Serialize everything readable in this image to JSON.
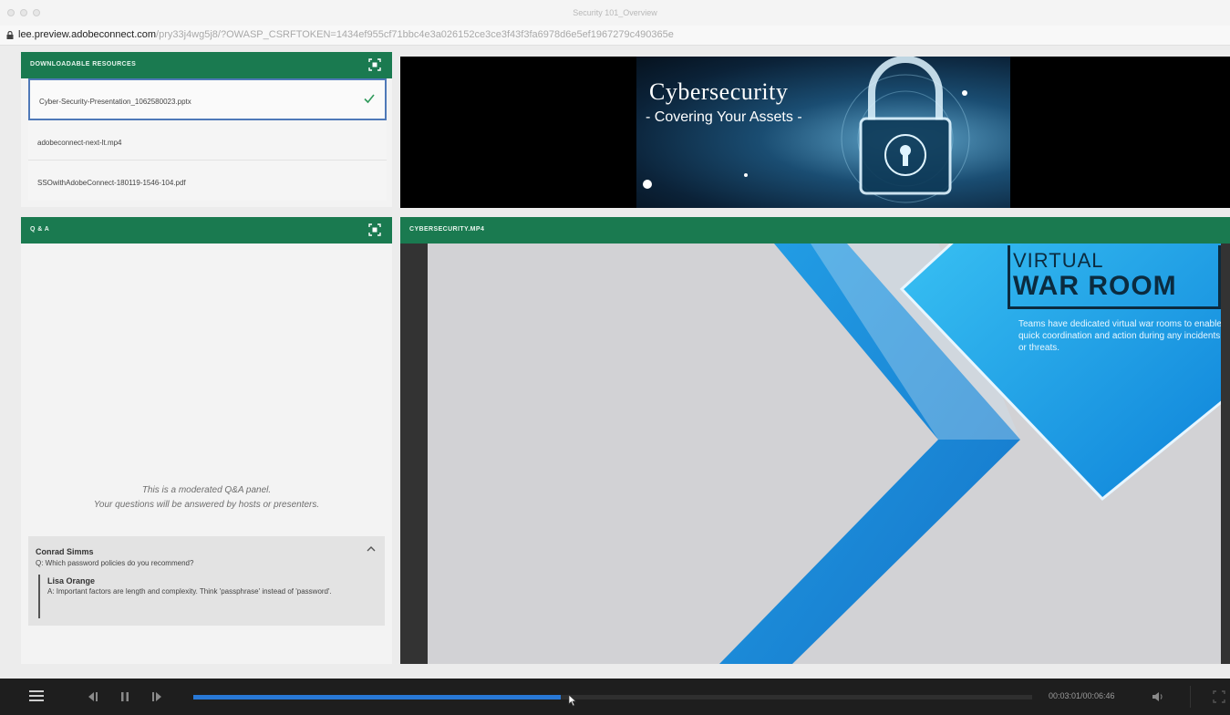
{
  "window": {
    "title": "Security 101_Overview"
  },
  "urlbar": {
    "host": "lee.preview.adobeconnect.com",
    "path": "/pry33j4wg5j8/?OWASP_CSRFTOKEN=1434ef955cf71bbc4e3a026152ce3ce3f43f3fa6978d6e5ef1967279c490365e"
  },
  "resources": {
    "title": "DOWNLOADABLE RESOURCES",
    "items": [
      {
        "name": "Cyber-Security-Presentation_1062580023.pptx",
        "selected": true
      },
      {
        "name": "adobeconnect-next-lt.mp4",
        "selected": false
      },
      {
        "name": "SSOwithAdobeConnect-180119-1546-104.pdf",
        "selected": false
      }
    ]
  },
  "banner": {
    "title": "Cybersecurity",
    "subtitle": "- Covering Your Assets -"
  },
  "qa": {
    "title": "Q & A",
    "message_line1": "This is a moderated Q&A panel.",
    "message_line2": "Your questions will be answered by hosts or presenters.",
    "entry": {
      "asker": "Conrad Simms",
      "question": "Q: Which password policies do you recommend?",
      "answerer": "Lisa Orange",
      "answer": "A: Important factors are length and complexity. Think 'passphrase' instead of 'password'."
    }
  },
  "video": {
    "title": "CYBERSECURITY.MP4",
    "slide_title1": "VIRTUAL",
    "slide_title2": "WAR ROOM",
    "slide_body": "Teams have dedicated virtual war rooms to enable quick coordination and action during any incidents or threats."
  },
  "player": {
    "time": "00:03:01/00:06:46",
    "progress": 0.438,
    "accent": "#2878d6"
  },
  "colors": {
    "panel_header": "#1a7a50",
    "selection": "#4f79b8"
  }
}
